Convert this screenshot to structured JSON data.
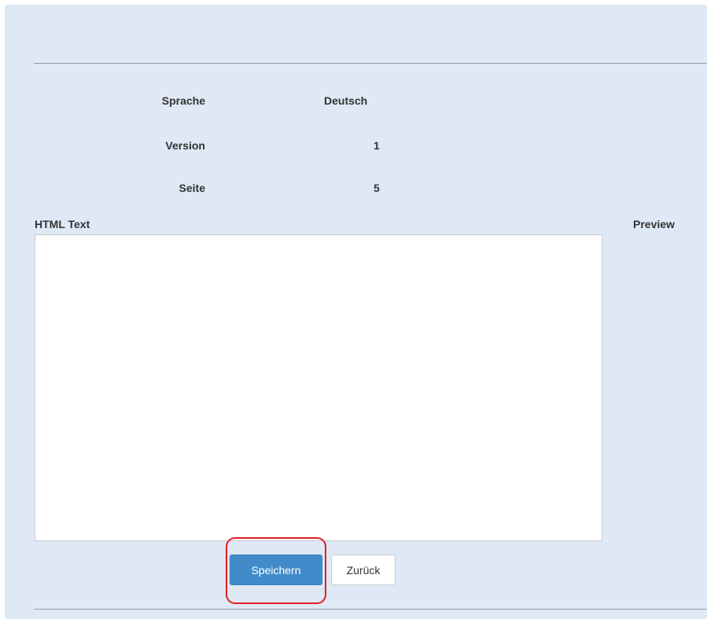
{
  "fields": {
    "language": {
      "label": "Sprache",
      "value": "Deutsch"
    },
    "version": {
      "label": "Version",
      "value": "1"
    },
    "page": {
      "label": "Seite",
      "value": "5"
    }
  },
  "editor": {
    "html_text_label": "HTML Text",
    "html_text_value": "",
    "preview_label": "Preview"
  },
  "buttons": {
    "save_label": "Speichern",
    "back_label": "Zurück"
  },
  "colors": {
    "panel_background": "#dfe8f5",
    "primary_button": "#428bca",
    "highlight": "#e02020"
  }
}
